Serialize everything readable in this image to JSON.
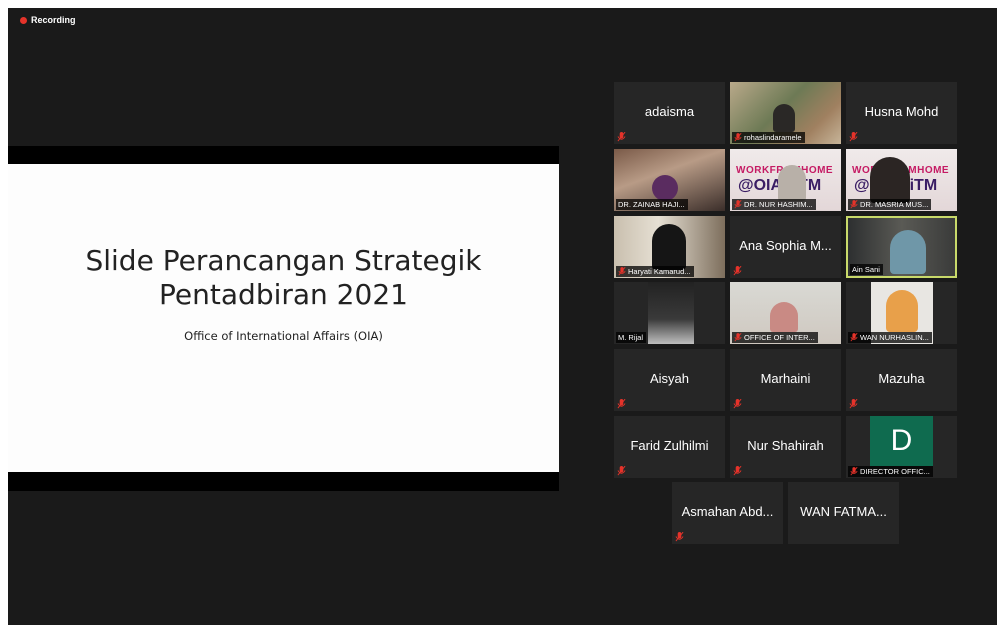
{
  "recording_label": "Recording",
  "slide": {
    "title_line1": "Slide Perancangan Strategik",
    "title_line2": "Pentadbiran 2021",
    "subtitle": "Office of International Affairs (OIA)"
  },
  "participants": {
    "adaisma": "adaisma",
    "rohaslinda": "rohaslindaramele",
    "husna": "Husna Mohd",
    "zainab": "DR. ZAINAB HAJI...",
    "nur_hashim": "DR. NUR HASHIM...",
    "masria": "DR. MASRIA MUS...",
    "haryati": "Haryati Kamarud...",
    "ana_sophia": "Ana Sophia M...",
    "ain_sani": "Ain Sani",
    "m_rijal": "M. Rijal",
    "office_inter": "OFFICE OF INTER...",
    "wan_nurhaslin": "WAN NURHASLIN...",
    "aisyah": "Aisyah",
    "marhaini": "Marhaini",
    "mazuha": "Mazuha",
    "farid": "Farid Zulhilmi",
    "nur_shahirah": "Nur Shahirah",
    "director": "DIRECTOR OFFIC...",
    "director_initial": "D",
    "asmahan": "Asmahan Abd...",
    "wan_fatma": "WAN FATMA..."
  },
  "virtual_background": {
    "line1": "WORKFROMHOME",
    "line2": "@OIAUiTM"
  },
  "colors": {
    "recording_dot": "#e5332a",
    "active_speaker_border": "#c8d96a",
    "muted_icon": "#e5332a",
    "director_avatar": "#0f6b4f"
  },
  "icons": {
    "muted": "mic-muted-icon"
  }
}
